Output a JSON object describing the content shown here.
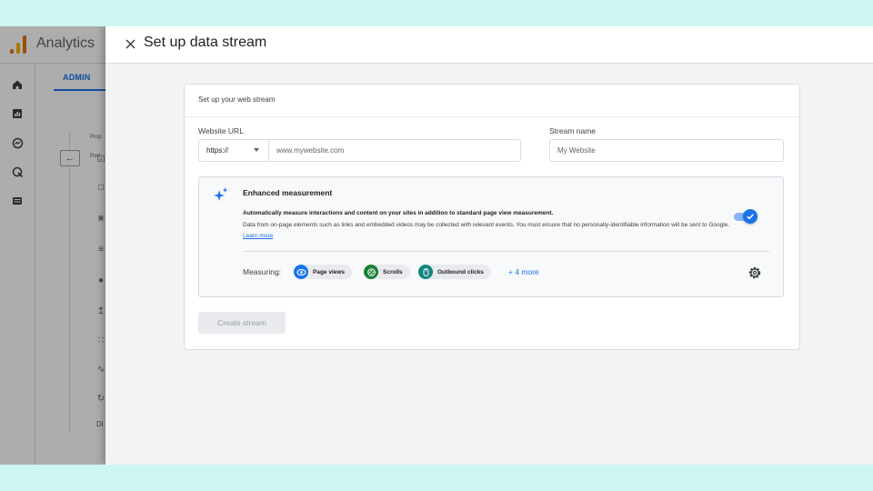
{
  "background_app": {
    "app_name": "Analytics",
    "admin_tab": "ADMIN",
    "truncated_labels": [
      "Prop",
      "Port",
      "Di"
    ],
    "rail_icons": [
      "home-icon",
      "reports-icon",
      "explore-icon",
      "advertising-icon",
      "configure-icon"
    ],
    "admin_gear_icon": "admin-gear-icon"
  },
  "dialog": {
    "title": "Set up data stream",
    "close_icon": "close-icon",
    "card": {
      "heading": "Set up your web stream",
      "website_url": {
        "label": "Website URL",
        "protocol": "https://",
        "placeholder": "www.mywebsite.com"
      },
      "stream_name": {
        "label": "Stream name",
        "placeholder": "My Website"
      },
      "enhanced_measurement": {
        "title": "Enhanced measurement",
        "description_bold": "Automatically measure interactions and content on your sites in addition to standard page view measurement.",
        "description": "Data from on-page elements such as links and embedded videos may be collected with relevant events. You must ensure that no personally-identifiable information will be sent to Google.",
        "learn_more": "Learn more",
        "enabled": true,
        "measuring_label": "Measuring:",
        "chips": [
          {
            "label": "Page views",
            "icon": "eye-icon",
            "color": "#1a73e8"
          },
          {
            "label": "Scrolls",
            "icon": "scroll-icon",
            "color": "#188038"
          },
          {
            "label": "Outbound clicks",
            "icon": "mouse-icon",
            "color": "#12867c"
          }
        ],
        "more": "+ 4 more"
      },
      "create_button": "Create stream"
    }
  },
  "colors": {
    "accent": "#1a73e8",
    "page_background": "#cdf6f0"
  }
}
